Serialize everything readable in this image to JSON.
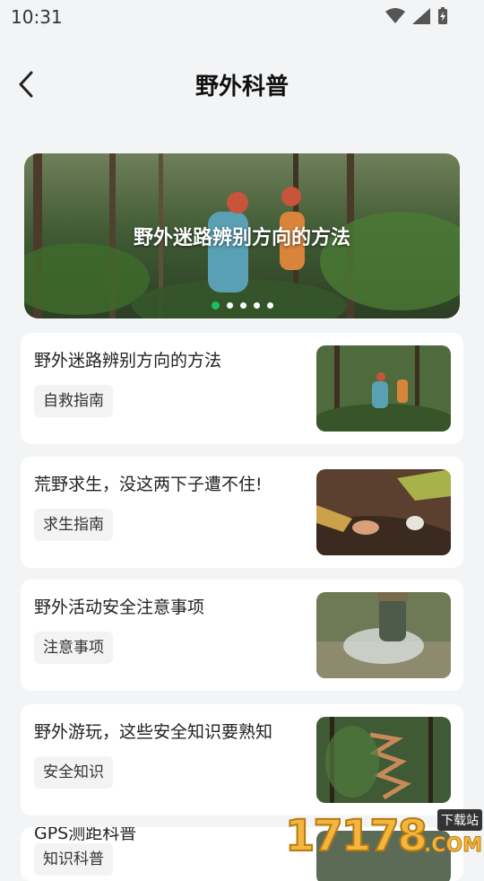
{
  "status": {
    "time": "10:31"
  },
  "header": {
    "title": "野外科普"
  },
  "banner": {
    "title": "野外迷路辨别方向的方法",
    "dots": 5,
    "active_dot": 0
  },
  "articles": [
    {
      "title": "野外迷路辨别方向的方法",
      "tag": "自救指南"
    },
    {
      "title": "荒野求生，没这两下子遭不住!",
      "tag": "求生指南"
    },
    {
      "title": "野外活动安全注意事项",
      "tag": "注意事项"
    },
    {
      "title": "野外游玩，这些安全知识要熟知",
      "tag": "安全知识"
    }
  ],
  "partial_article": {
    "title": "GPS测距科普",
    "tag": "知识科普"
  },
  "watermark": {
    "number": "17178",
    "download": "下载站",
    "com": ".COM"
  }
}
